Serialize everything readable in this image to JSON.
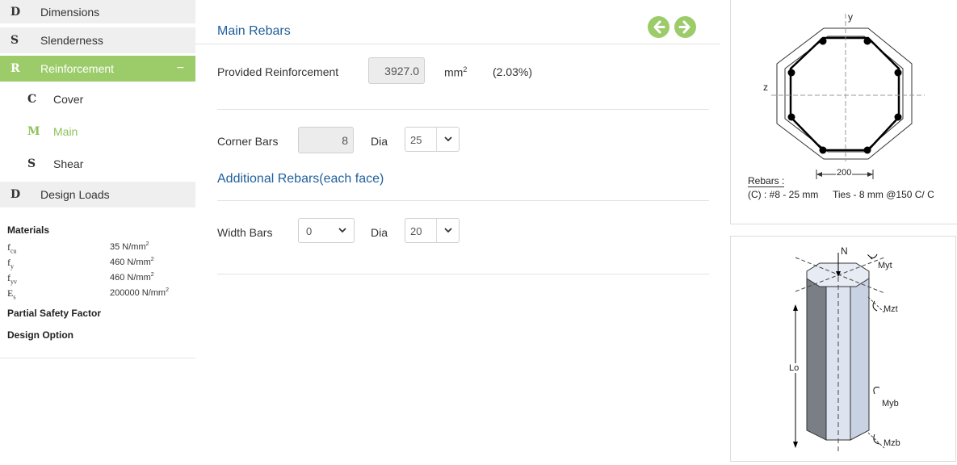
{
  "sidebar": {
    "items": [
      {
        "letter": "D",
        "label": "Dimensions"
      },
      {
        "letter": "S",
        "label": "Slenderness"
      },
      {
        "letter": "R",
        "label": "Reinforcement",
        "toggle": "−"
      },
      {
        "letter": "C",
        "label": "Cover"
      },
      {
        "letter": "M",
        "label": "Main"
      },
      {
        "letter": "S",
        "label": "Shear"
      },
      {
        "letter": "D",
        "label": "Design Loads"
      }
    ],
    "materials_title": "Materials",
    "materials": [
      {
        "sym": "f",
        "sub": "cu",
        "value": "35 N/mm",
        "unit_sup": "2"
      },
      {
        "sym": "f",
        "sub": "y",
        "value": "460 N/mm",
        "unit_sup": "2"
      },
      {
        "sym": "f",
        "sub": "yv",
        "value": "460 N/mm",
        "unit_sup": "2"
      },
      {
        "sym": "E",
        "sub": "s",
        "value": "200000 N/mm",
        "unit_sup": "2"
      }
    ],
    "partial_safety_factor": "Partial Safety Factor",
    "design_option": "Design Option"
  },
  "main": {
    "main_rebars_title": "Main Rebars",
    "provided_label": "Provided Reinforcement",
    "provided_value": "3927.0",
    "provided_unit": "mm",
    "provided_unit_sup": "2",
    "provided_percent": "(2.03%)",
    "corner_label": "Corner Bars",
    "corner_value": "8",
    "dia_label": "Dia",
    "corner_dia": "25",
    "additional_title": "Additional Rebars(each face)",
    "width_label": "Width Bars",
    "width_value": "0",
    "width_dia": "20"
  },
  "section_diagram": {
    "y_axis": "y",
    "z_axis": "z",
    "dimension": "200",
    "rebars_label": "Rebars :",
    "rebars_detail": "(C) : #8 - 25 mm",
    "ties_detail": "Ties - 8 mm @150 C/ C"
  },
  "column_diagram": {
    "n_label": "N",
    "myt": "Myt",
    "mzt": "Mzt",
    "myb": "Myb",
    "mzb": "Mzb",
    "lo": "Lo"
  },
  "colors": {
    "accent_green": "#9ccc6a",
    "title_blue": "#1f5f9b"
  }
}
